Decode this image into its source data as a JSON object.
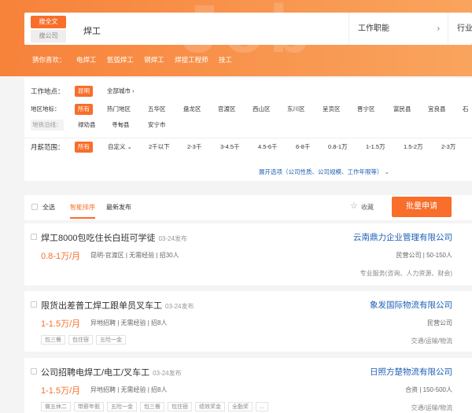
{
  "hero": {
    "watermark": "Job Sea"
  },
  "search": {
    "type_active": "搜全文",
    "type_inactive": "搜公司",
    "keyword": "焊工",
    "field1": "工作职能",
    "field2": "行业",
    "guess_label": "猜你喜欢：",
    "guesses": [
      "电焊工",
      "氩弧焊工",
      "钢焊工",
      "焊接工程师",
      "技工"
    ]
  },
  "filter": {
    "location_label": "工作地点：",
    "location_selected": "昆明",
    "all_cities": "全部城市",
    "district_label": "地区地标：",
    "districts": [
      "所有",
      "热门地区",
      "五华区",
      "盘龙区",
      "官渡区",
      "西山区",
      "东川区",
      "呈贡区",
      "晋宁区",
      "富民县",
      "宜良县",
      "石"
    ],
    "metro_label": "地铁沿线：",
    "metro": [
      "禄劝县",
      "寻甸县",
      "安宁市"
    ],
    "salary_label": "月薪范围：",
    "salaries": [
      "所有",
      "自定义",
      "2千以下",
      "2-3千",
      "3-4.5千",
      "4.5-6千",
      "6-8千",
      "0.8-1万",
      "1-1.5万",
      "1.5-2万",
      "2-3万"
    ],
    "expand": "展开选项（公司性质、公司规模、工作年限等）"
  },
  "toolbar": {
    "select_all": "全选",
    "sort_smart": "智能排序",
    "sort_new": "最新发布",
    "favorite": "收藏",
    "batch_apply": "批量申请"
  },
  "jobs": [
    {
      "title": "焊工8000包吃住长白班可学徒",
      "time": "03-24发布",
      "salary": "0.8-1万/月",
      "info": "昆明-官渡区 | 无需经验 | 招30人",
      "company": "云南鼎力企业管理有限公司",
      "company_meta": "民营公司 | 50-150人",
      "industry": "专业服务(咨询、人力资源、财会)",
      "tags": []
    },
    {
      "title": "限货出差普工焊工跟单员叉车工",
      "time": "03-24发布",
      "salary": "1-1.5万/月",
      "info": "异地招聘 | 无需经验 | 招8人",
      "company": "象发国际物流有限公司",
      "company_meta": "民营公司",
      "industry": "交通/运输/物流",
      "tags": [
        "包三餐",
        "包住宿",
        "五险一金"
      ]
    },
    {
      "title": "公司招聘电焊工/电工/叉车工",
      "time": "03-24发布",
      "salary": "1-1.5万/月",
      "info": "异地招聘 | 无需经验 | 招8人",
      "company": "日照方楚物流有限公司",
      "company_meta": "合资 | 150-500人",
      "industry": "交通/运输/物流",
      "tags": [
        "做五休二",
        "带薪年假",
        "五险一金",
        "包三餐",
        "包住宿",
        "绩效奖金",
        "全勤奖",
        "..."
      ]
    }
  ],
  "colors": {
    "accent": "#f86e2a",
    "company_link": "#1e5fb7"
  }
}
